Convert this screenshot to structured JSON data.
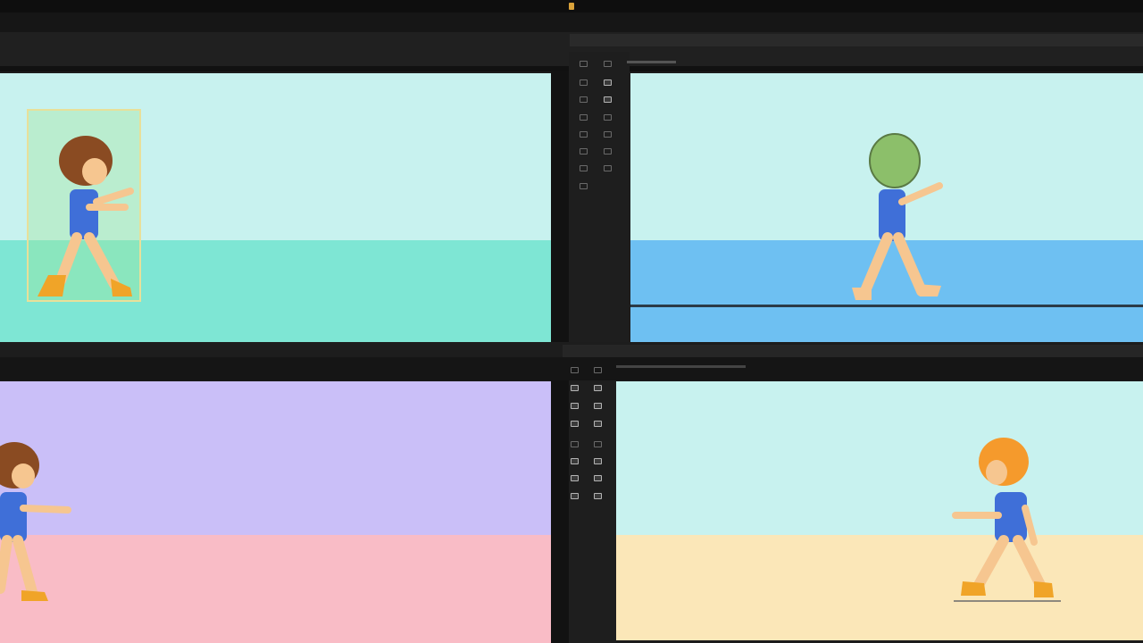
{
  "app": {
    "title_bar_text": "",
    "menu_items": [
      "",
      "",
      "",
      "",
      ""
    ]
  },
  "icons": {
    "toolbar_left": [
      "grid-icon",
      "layers-icon",
      "move-icon",
      "scale-icon",
      "rotate-icon",
      "crop-icon",
      "mask-icon",
      "pen-icon"
    ],
    "toolbar_right": [
      "select-icon",
      "crop-icon",
      "grid-icon",
      "link-icon",
      "rotate-icon",
      "mask-icon",
      "layers-icon",
      "pen-icon"
    ]
  },
  "colors": {
    "app_background": "#1b1b1b",
    "scene1_sky": "#c8f2ef",
    "scene1_ground": "#7ee6d4",
    "scene2_sky": "#c8f2ef",
    "scene2_ground": "#6ec0f2",
    "scene3_sky": "#cabff8",
    "scene3_ground": "#f9bcc6",
    "scene4_sky": "#c8f2ef",
    "scene4_ground": "#fbe7b8",
    "selection_outline": "#e8e09a",
    "character_shirt": "#3f6fd8",
    "character_pants": "#f6c690",
    "character_hair_brown": "#8a4b22",
    "character_hair_orange": "#f59a2c",
    "character_head_green": "#8cbf6a",
    "character_shoes": "#f0a428"
  }
}
